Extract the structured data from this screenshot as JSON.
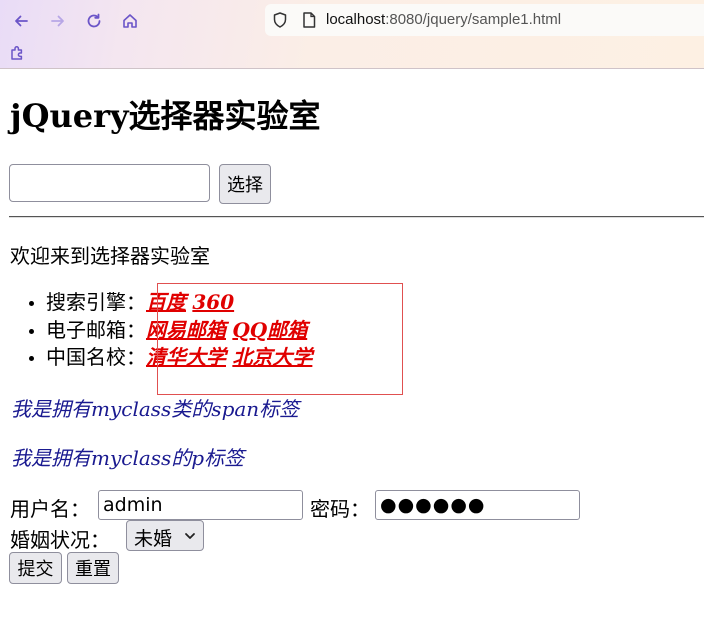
{
  "browser": {
    "url_host": "localhost",
    "url_rest": ":8080/jquery/sample1.html"
  },
  "page": {
    "title": "jQuery选择器实验室",
    "selector_button": "选择",
    "welcome": "欢迎来到选择器实验室",
    "list": [
      {
        "label": "搜索引擎：",
        "links": [
          "百度",
          "360"
        ]
      },
      {
        "label": "电子邮箱：",
        "links": [
          "网易邮箱",
          "QQ邮箱"
        ]
      },
      {
        "label": "中国名校：",
        "links": [
          "清华大学",
          "北京大学"
        ]
      }
    ],
    "span_text": "我是拥有myclass类的span标签",
    "p_text": "我是拥有myclass的p标签",
    "form": {
      "username_label": "用户名：",
      "username_value": "admin",
      "password_label": "密码：",
      "password_value": "●●●●●●",
      "marital_label": "婚姻状况：",
      "marital_value": "未婚",
      "submit": "提交",
      "reset": "重置"
    }
  }
}
